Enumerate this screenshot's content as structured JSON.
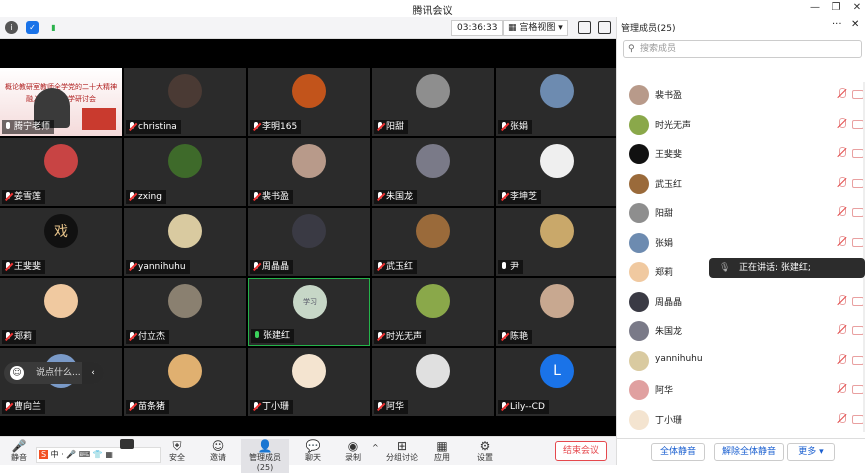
{
  "window": {
    "title": "腾讯会议"
  },
  "toolbar": {
    "timer": "03:36:33",
    "view": "宫格视图"
  },
  "tiles": [
    {
      "name": "腾宁老师",
      "muted": false,
      "color": "#c93a2e",
      "share_line1": "概论教研室教师全学党的二十大精神",
      "share_line2": "融入思政课教学研讨会"
    },
    {
      "name": "christina",
      "muted": true,
      "color": "#4a3a34"
    },
    {
      "name": "李明165",
      "muted": true,
      "color": "#c2541b"
    },
    {
      "name": "阳甜",
      "muted": true,
      "color": "#8e8e8e"
    },
    {
      "name": "张娟",
      "muted": true,
      "color": "#6d8bb0"
    },
    {
      "name": "姜雪莲",
      "muted": true,
      "color": "#c84444"
    },
    {
      "name": "zxing",
      "muted": true,
      "color": "#3e6a2a"
    },
    {
      "name": "裴书盈",
      "muted": true,
      "color": "#b89a8a"
    },
    {
      "name": "朱国龙",
      "muted": true,
      "color": "#7a7a88"
    },
    {
      "name": "李坤芝",
      "muted": true,
      "color": "#efefef"
    },
    {
      "name": "王斐斐",
      "muted": true,
      "color": "#111111",
      "glyph": "戏"
    },
    {
      "name": "yannihuhu",
      "muted": true,
      "color": "#d9caa0"
    },
    {
      "name": "周晶晶",
      "muted": true,
      "color": "#3a3a44"
    },
    {
      "name": "武玉红",
      "muted": true,
      "color": "#9a6a3a"
    },
    {
      "name": "尹",
      "muted": false,
      "color": "#c9a86a"
    },
    {
      "name": "郑莉",
      "muted": true,
      "color": "#f0c9a0"
    },
    {
      "name": "付立杰",
      "muted": true,
      "color": "#8a8070"
    },
    {
      "name": "张建红",
      "muted": false,
      "speaking": true,
      "color": "#c7d7c7",
      "glyph": "学习"
    },
    {
      "name": "时光无声",
      "muted": true,
      "color": "#8aa84a"
    },
    {
      "name": "陈艳",
      "muted": true,
      "color": "#c8a890"
    },
    {
      "name": "曹向兰",
      "muted": true,
      "color": "#7a9ac8"
    },
    {
      "name": "苗条猪",
      "muted": true,
      "color": "#e0b070"
    },
    {
      "name": "丁小珊",
      "muted": true,
      "color": "#f4e4d0"
    },
    {
      "name": "阿华",
      "muted": true,
      "color": "#e0e0e0"
    },
    {
      "name": "Lily--CD",
      "muted": true,
      "color": "#1a73e8",
      "glyph": "L"
    }
  ],
  "chat": {
    "placeholder": "说点什么..."
  },
  "bottom": {
    "items": [
      {
        "label": "静音",
        "icon": "mic-icon",
        "glyph": "🎤"
      },
      {
        "label": "安全",
        "icon": "shield-icon",
        "glyph": "⛨"
      },
      {
        "label": "邀请",
        "icon": "invite-icon",
        "glyph": "☺"
      },
      {
        "label": "管理成员(25)",
        "icon": "members-icon",
        "glyph": "👤"
      },
      {
        "label": "聊天",
        "icon": "chat-icon",
        "glyph": "💬"
      },
      {
        "label": "录制",
        "icon": "record-icon",
        "glyph": "◉"
      },
      {
        "label": "分组讨论",
        "icon": "breakout-icon",
        "glyph": "⊞"
      },
      {
        "label": "应用",
        "icon": "apps-icon",
        "glyph": "▦"
      },
      {
        "label": "设置",
        "icon": "settings-icon",
        "glyph": "⚙"
      }
    ],
    "end": "结束会议"
  },
  "panel": {
    "title": "管理成员(25)",
    "search_placeholder": "搜索成员",
    "members": [
      {
        "name": "裴书盈",
        "color": "#b89a8a"
      },
      {
        "name": "时光无声",
        "color": "#8aa84a"
      },
      {
        "name": "王斐斐",
        "color": "#111111"
      },
      {
        "name": "武玉红",
        "color": "#9a6a3a"
      },
      {
        "name": "阳甜",
        "color": "#8e8e8e"
      },
      {
        "name": "张娟",
        "color": "#6d8bb0"
      },
      {
        "name": "郑莉",
        "color": "#f0c9a0"
      },
      {
        "name": "周晶晶",
        "color": "#3a3a44"
      },
      {
        "name": "朱国龙",
        "color": "#7a7a88"
      },
      {
        "name": "yannihuhu",
        "color": "#d9caa0"
      },
      {
        "name": "阿华",
        "color": "#e0a0a0"
      },
      {
        "name": "丁小珊",
        "color": "#f4e4d0"
      }
    ],
    "btn_mute_all": "全体静音",
    "btn_unmute_all": "解除全体静音",
    "btn_more": "更多",
    "speaking": "正在讲话: 张建红;"
  }
}
